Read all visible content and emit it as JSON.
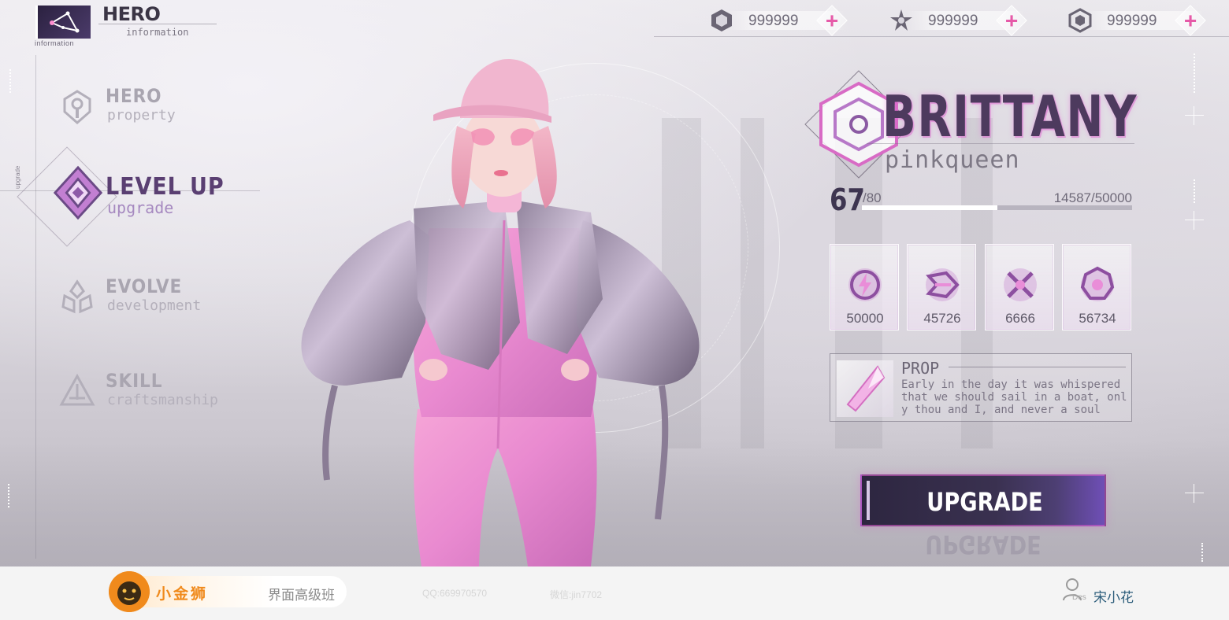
{
  "app": {
    "logo_title": "HERO",
    "logo_subtitle": "information",
    "logo_caption": "information"
  },
  "nav": {
    "side_text": "upgrade",
    "items": [
      {
        "title": "HERO",
        "subtitle": "property",
        "icon": "key-icon",
        "active": false
      },
      {
        "title": "LEVEL UP",
        "subtitle": "upgrade",
        "icon": "diamond-icon",
        "active": true
      },
      {
        "title": "EVOLVE",
        "subtitle": "development",
        "icon": "evolve-icon",
        "active": false
      },
      {
        "title": "SKILL",
        "subtitle": "craftsmanship",
        "icon": "skill-icon",
        "active": false
      }
    ]
  },
  "currencies": [
    {
      "icon": "hexagon-gem-icon",
      "value": "999999",
      "add_label": "+"
    },
    {
      "icon": "star-crystal-icon",
      "value": "999999",
      "add_label": "+"
    },
    {
      "icon": "hex-coin-icon",
      "value": "999999",
      "add_label": "+"
    }
  ],
  "hero": {
    "name": "BRITTANY",
    "title": "pinkqueen",
    "level": "67",
    "level_max": "/80",
    "exp_text": "14587/50000",
    "exp_fraction": 0.5
  },
  "stats": [
    {
      "icon": "energy-ring-icon",
      "value": "50000"
    },
    {
      "icon": "shield-layers-icon",
      "value": "45726"
    },
    {
      "icon": "crossed-blades-icon",
      "value": "6666"
    },
    {
      "icon": "gear-core-icon",
      "value": "56734"
    }
  ],
  "prop": {
    "title": "PROP",
    "description": "Early in the day it was whispered that we should sail in a boat, only thou and I, and never a soul",
    "icon": "pink-crystal-icon"
  },
  "upgrade_button": {
    "label": "UPGRADE"
  },
  "footer": {
    "brand_name": "小金狮",
    "course": "界面高级班",
    "qq": "QQ:669970570",
    "wechat": "微信:jin7702",
    "author_tag": "Des",
    "author_name": "宋小花"
  },
  "colors": {
    "accent_pink": "#e65aa8",
    "nav_active": "#5a3f72",
    "button_dark": "#2d2640",
    "brand_orange": "#f08a1c"
  }
}
